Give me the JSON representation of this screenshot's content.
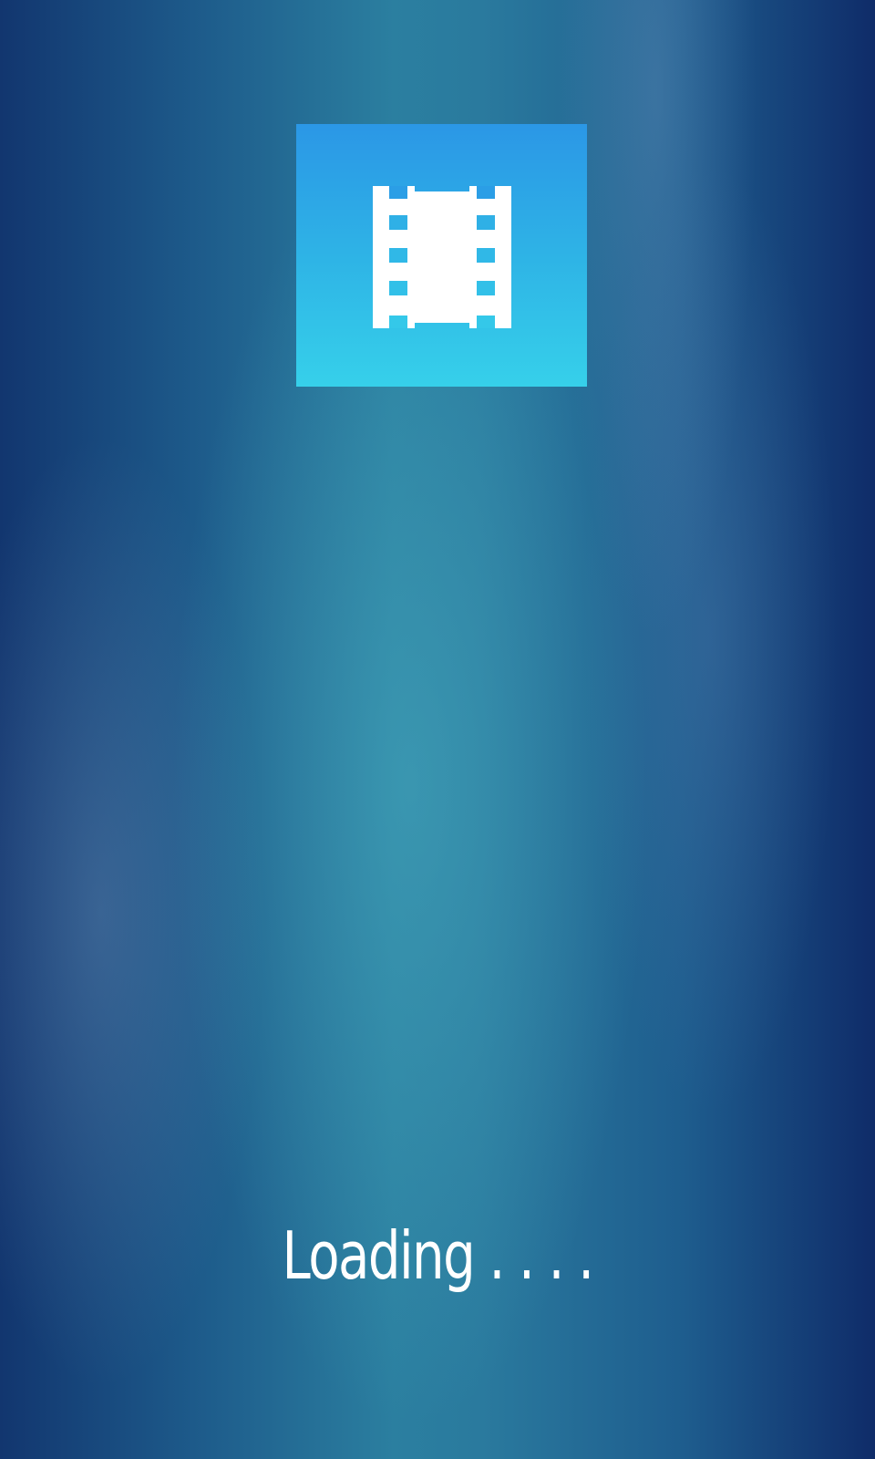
{
  "app": {
    "icon": "film-strip-icon",
    "colors": {
      "icon_tile_top": "#2b97e6",
      "icon_tile_bottom": "#36d0ea",
      "background_edge": "#0f2c69",
      "background_center": "#2b7fa0",
      "text": "#ffffff"
    }
  },
  "status": {
    "loading_text": "Loading . . . ."
  }
}
